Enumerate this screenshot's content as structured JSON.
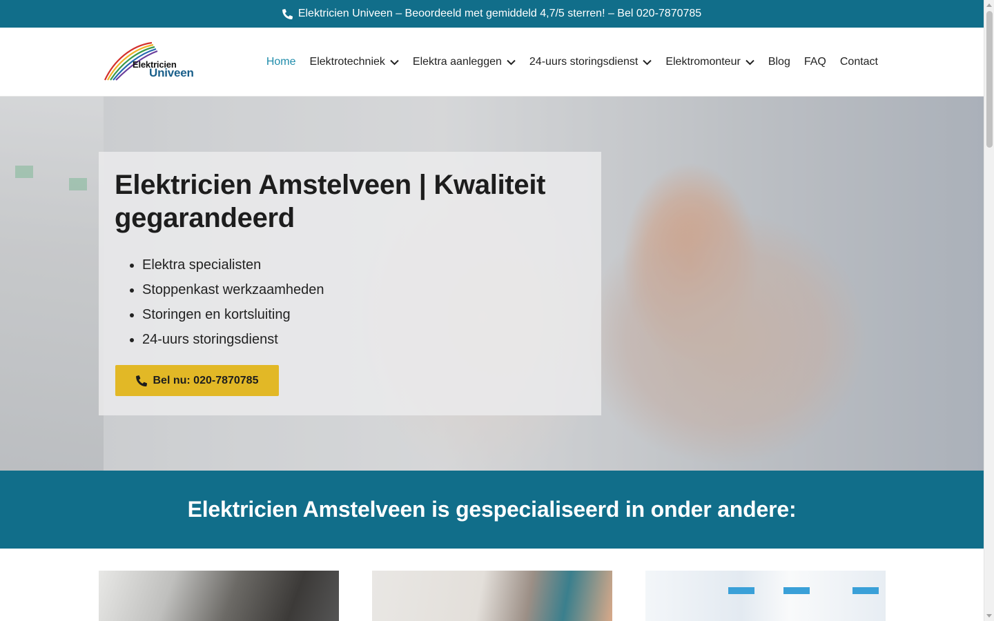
{
  "topbar": {
    "icon": "phone-icon",
    "text": "Elektricien Univeen – Beoordeeld met gemiddeld 4,7/5 sterren! – Bel 020-7870785"
  },
  "logo": {
    "line1": "Elektricien",
    "line2": "Univeen"
  },
  "nav": {
    "items": [
      {
        "label": "Home",
        "active": true,
        "dropdown": false
      },
      {
        "label": "Elektrotechniek",
        "dropdown": true
      },
      {
        "label": "Elektra aanleggen",
        "dropdown": true
      },
      {
        "label": "24-uurs storingsdienst",
        "dropdown": true
      },
      {
        "label": "Elektromonteur",
        "dropdown": true
      },
      {
        "label": "Blog",
        "dropdown": false
      },
      {
        "label": "FAQ",
        "dropdown": false
      },
      {
        "label": "Contact",
        "dropdown": false
      }
    ]
  },
  "hero": {
    "title": "Elektricien Amstelveen | Kwaliteit gegarandeerd",
    "bullets": [
      "Elektra specialisten",
      "Stoppenkast werkzaamheden",
      "Storingen en kortsluiting",
      "24-uurs storingsdienst"
    ],
    "cta_label": "Bel nu: 020-7870785"
  },
  "band": {
    "heading": "Elektricien Amstelveen is gespecialiseerd in onder andere:"
  },
  "colors": {
    "primary": "#116e8a",
    "accent": "#e2b826",
    "nav_active": "#1f8cab"
  }
}
